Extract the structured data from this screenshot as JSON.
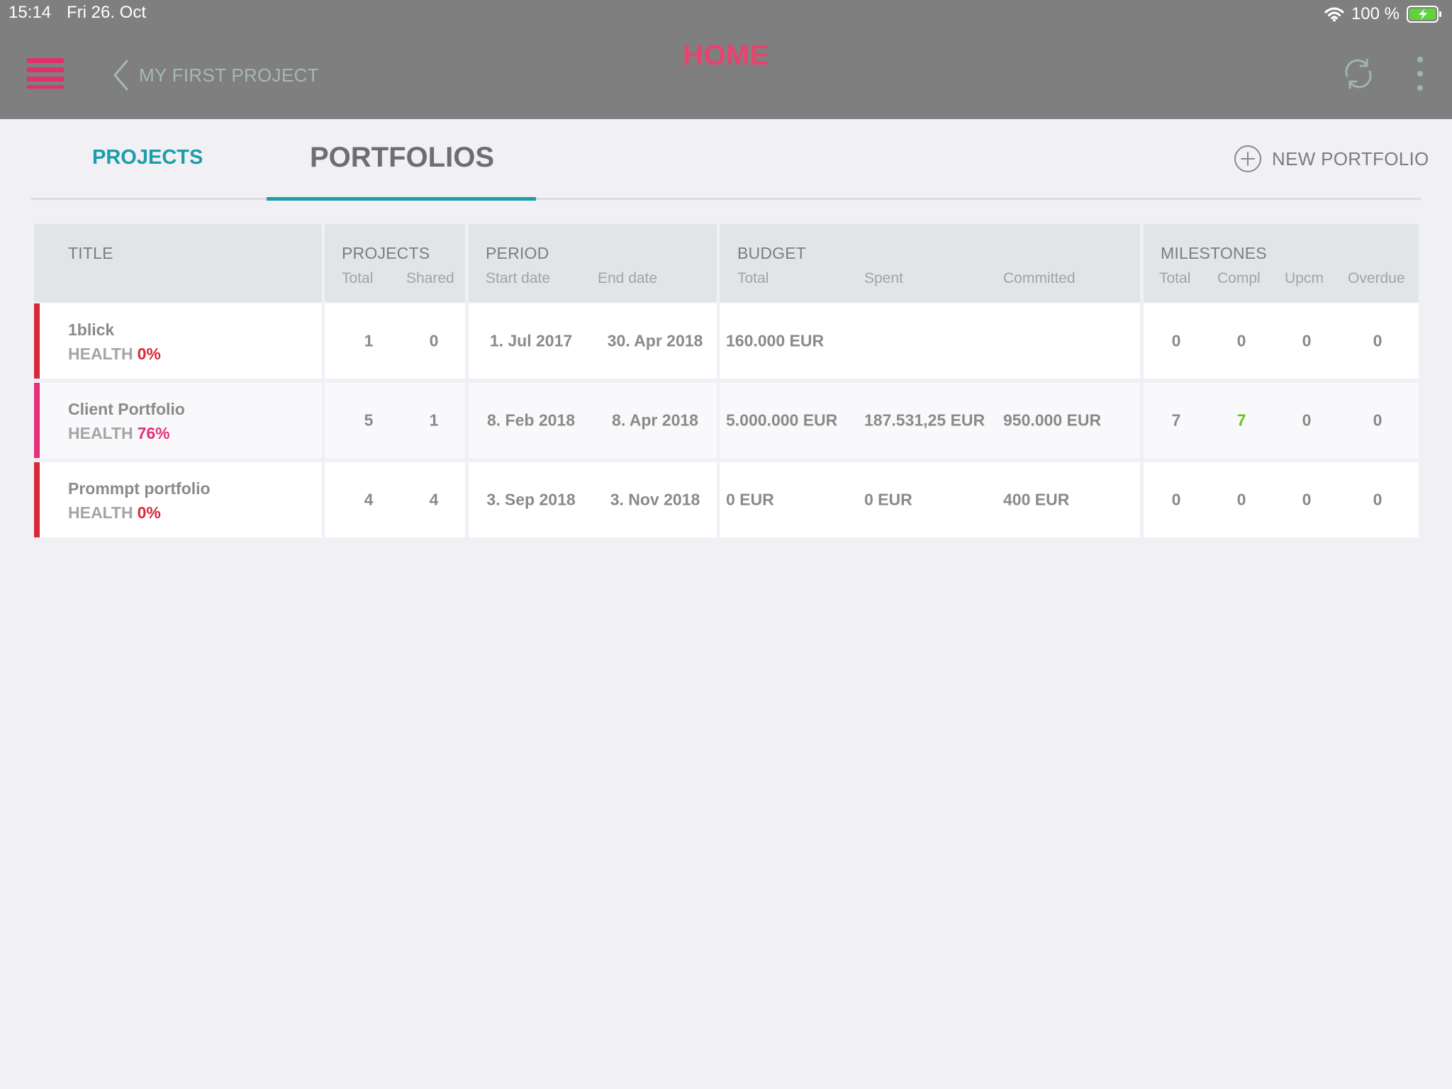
{
  "status_bar": {
    "time": "15:14",
    "date": "Fri 26. Oct",
    "battery": "100 %"
  },
  "header": {
    "back_label": "MY FIRST PROJECT",
    "title": "HOME"
  },
  "tabs": {
    "projects": "PROJECTS",
    "portfolios": "PORTFOLIOS",
    "active": "portfolios"
  },
  "actions": {
    "new_portfolio": "NEW PORTFOLIO"
  },
  "icons": [
    "hamburger-menu-icon",
    "chevron-left-icon",
    "sync-icon",
    "more-vertical-icon",
    "plus-circle-icon",
    "wifi-icon",
    "battery-charging-icon"
  ],
  "colors": {
    "accent": "#1a9eaa",
    "brand": "#e8436e",
    "health_low": "#d7283a",
    "health_mid": "#e3307b",
    "complete": "#6ac21e",
    "topbar": "#7f7f7f"
  },
  "table": {
    "headers": {
      "title": "TITLE",
      "projects": {
        "label": "PROJECTS",
        "sub": [
          "Total",
          "Shared"
        ]
      },
      "period": {
        "label": "PERIOD",
        "sub": [
          "Start date",
          "End date"
        ]
      },
      "budget": {
        "label": "BUDGET",
        "sub": [
          "Total",
          "Spent",
          "Committed"
        ]
      },
      "milestones": {
        "label": "MILESTONES",
        "sub": [
          "Total",
          "Compl",
          "Upcm",
          "Overdue"
        ]
      }
    },
    "rows": [
      {
        "name": "1blick",
        "health_label": "HEALTH",
        "health": "0%",
        "health_color": "#d7283a",
        "projects_total": "1",
        "projects_shared": "0",
        "start": "1. Jul 2017",
        "end": "30. Apr 2018",
        "budget_total": "160.000 EUR",
        "budget_spent": "",
        "budget_committed": "",
        "ms_total": "0",
        "ms_compl": "0",
        "ms_upcm": "0",
        "ms_overdue": "0"
      },
      {
        "name": "Client Portfolio",
        "health_label": "HEALTH",
        "health": "76%",
        "health_color": "#e3307b",
        "projects_total": "5",
        "projects_shared": "1",
        "start": "8. Feb 2018",
        "end": "8. Apr 2018",
        "budget_total": "5.000.000 EUR",
        "budget_spent": "187.531,25 EUR",
        "budget_committed": "950.000 EUR",
        "ms_total": "7",
        "ms_compl": "7",
        "ms_upcm": "0",
        "ms_overdue": "0"
      },
      {
        "name": "Prommpt portfolio",
        "health_label": "HEALTH",
        "health": "0%",
        "health_color": "#d7283a",
        "projects_total": "4",
        "projects_shared": "4",
        "start": "3. Sep 2018",
        "end": "3. Nov 2018",
        "budget_total": "0 EUR",
        "budget_spent": "0 EUR",
        "budget_committed": "400 EUR",
        "ms_total": "0",
        "ms_compl": "0",
        "ms_upcm": "0",
        "ms_overdue": "0"
      }
    ]
  }
}
